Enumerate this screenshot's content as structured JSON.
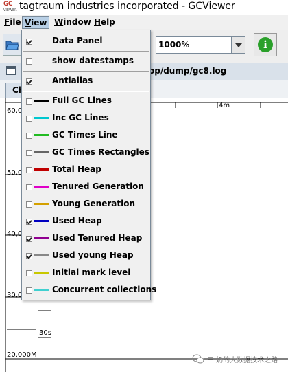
{
  "window": {
    "title": "tagtraum industries incorporated - GCViewer",
    "logo_top": "GC",
    "logo_bottom": "VIEWER"
  },
  "menubar": {
    "items": [
      {
        "label": "File",
        "mnemonic": "F",
        "rest": "ile",
        "active": false
      },
      {
        "label": "View",
        "mnemonic": "V",
        "rest": "iew",
        "active": true
      },
      {
        "label": "Window",
        "mnemonic": "W",
        "rest": "indow",
        "active": false
      },
      {
        "label": "Help",
        "mnemonic": "H",
        "rest": "elp",
        "active": false
      }
    ]
  },
  "toolbar": {
    "zoom_value": "1000%",
    "open_icon": "folder-open-icon",
    "info_icon": "info-icon"
  },
  "frame": {
    "path_fragment": "op/dump/gc8.log",
    "tab_label": "Ch"
  },
  "chart": {
    "y_labels": [
      "60,0",
      "50,0",
      "40,0",
      "30,0"
    ],
    "x_labels": [
      "4m",
      "30s"
    ],
    "bottom_label": "20.000M"
  },
  "view_menu": {
    "items": [
      {
        "label": "Data Panel",
        "checked": true,
        "swatch": null
      },
      {
        "label": "show datestamps",
        "checked": false,
        "swatch": null
      },
      {
        "label": "Antialias",
        "checked": true,
        "swatch": null
      },
      {
        "label": "Full GC Lines",
        "checked": false,
        "swatch": "#000000"
      },
      {
        "label": "Inc GC Lines",
        "checked": false,
        "swatch": "#00c8d0"
      },
      {
        "label": "GC Times Line",
        "checked": false,
        "swatch": "#22bb22"
      },
      {
        "label": "GC Times Rectangles",
        "checked": false,
        "swatch": "#666666"
      },
      {
        "label": "Total Heap",
        "checked": false,
        "swatch": "#c00000"
      },
      {
        "label": "Tenured Generation",
        "checked": false,
        "swatch": "#e000c8"
      },
      {
        "label": "Young Generation",
        "checked": false,
        "swatch": "#d4a000"
      },
      {
        "label": "Used Heap",
        "checked": true,
        "swatch": "#0000c0"
      },
      {
        "label": "Used Tenured Heap",
        "checked": true,
        "swatch": "#900090"
      },
      {
        "label": "Used young Heap",
        "checked": true,
        "swatch": "#888888"
      },
      {
        "label": "Initial mark level",
        "checked": false,
        "swatch": "#c8c800"
      },
      {
        "label": "Concurrent collections",
        "checked": false,
        "swatch": "#40d0d0"
      }
    ]
  },
  "watermark": {
    "text": "三 奶的大数据技术之路",
    "icon": "wechat-icon"
  }
}
